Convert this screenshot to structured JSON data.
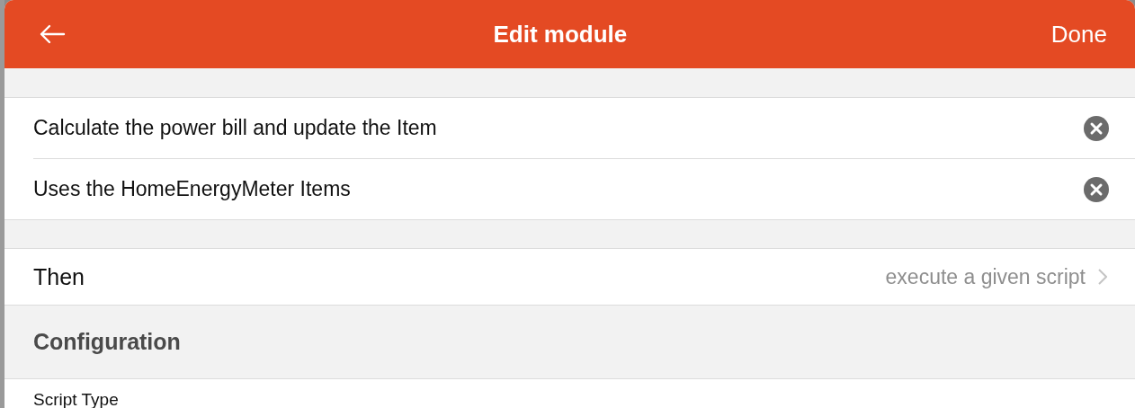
{
  "header": {
    "title": "Edit module",
    "done": "Done"
  },
  "fields": [
    {
      "value": "Calculate the power bill and update the Item"
    },
    {
      "value": "Uses the HomeEnergyMeter Items"
    }
  ],
  "then": {
    "label": "Then",
    "value": "execute a given script"
  },
  "configuration": {
    "title": "Configuration",
    "fields": [
      {
        "label": "Script Type"
      }
    ]
  }
}
